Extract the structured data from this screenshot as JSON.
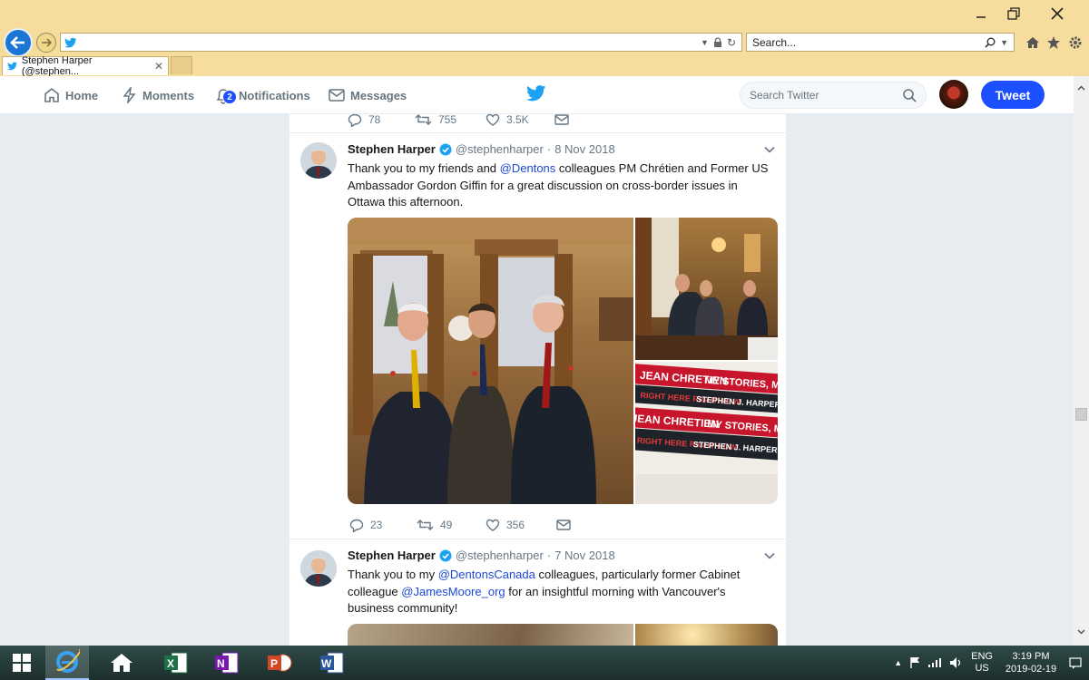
{
  "browser": {
    "search_placeholder": "Search...",
    "tab_title": "Stephen Harper (@stephen...",
    "tab_close": "✕"
  },
  "twitter_nav": {
    "home": "Home",
    "moments": "Moments",
    "notifications": "Notifications",
    "notifications_count": "2",
    "messages": "Messages",
    "search_placeholder": "Search Twitter",
    "tweet_button": "Tweet"
  },
  "previous_tweet_actions": {
    "replies": "78",
    "retweets": "755",
    "likes": "3.5K"
  },
  "tweets": [
    {
      "name": "Stephen Harper",
      "handle": "@stephenharper",
      "separator": "·",
      "date": "8 Nov 2018",
      "text_1": "Thank you to my friends and ",
      "mention_1": "@Dentons",
      "text_2": " colleagues PM Chrétien and Former US Ambassador Gordon Giffin for a great discussion on cross-border issues in Ottawa this afternoon.",
      "replies": "23",
      "retweets": "49",
      "likes": "356",
      "book_line_1": "JEAN CHRETIEN",
      "book_line_2": "MY STORIES, MY TIMES",
      "book_line_3": "RIGHT HERE RIGHT NOW",
      "book_line_4": "STEPHEN J. HARPER"
    },
    {
      "name": "Stephen Harper",
      "handle": "@stephenharper",
      "separator": "·",
      "date": "7 Nov 2018",
      "text_1": "Thank you to my ",
      "mention_1": "@DentonsCanada",
      "text_2": " colleagues, particularly former Cabinet colleague ",
      "mention_2": "@JamesMoore_org",
      "text_3": " for an insightful morning with Vancouver's business community!"
    }
  ],
  "taskbar": {
    "lang_1": "ENG",
    "lang_2": "US",
    "time": "3:19 PM",
    "date": "2019-02-19"
  },
  "colors": {
    "ie_frame": "#f6dc9d",
    "twitter_blue": "#1da1f2",
    "tweet_button": "#1c4fff",
    "link": "#1b48d8"
  }
}
